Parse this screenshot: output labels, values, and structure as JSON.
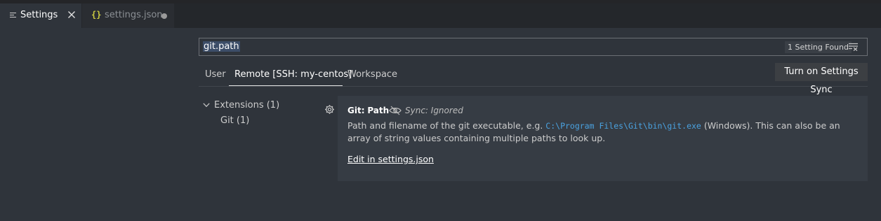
{
  "tabs": [
    {
      "label": "Settings",
      "active": true
    },
    {
      "label": "settings.json",
      "dirty": true
    }
  ],
  "search": {
    "value": "git.path",
    "result_count": "1 Setting Found"
  },
  "scopes": [
    {
      "label": "User"
    },
    {
      "label": "Remote [SSH: my-centos]",
      "selected": true
    },
    {
      "label": "Workspace"
    }
  ],
  "sync_button": "Turn on Settings Sync",
  "toc": {
    "extensions": "Extensions (1)",
    "git": "Git (1)"
  },
  "setting": {
    "category": "Git:",
    "name": "Path",
    "sync_status": "Sync: Ignored",
    "description_before": "Path and filename of the git executable, e.g. ",
    "description_code": "C:\\Program Files\\Git\\bin\\git.exe",
    "description_after": " (Windows). This can also be an array of string values containing multiple paths to look up.",
    "edit_link": "Edit in settings.json"
  },
  "colors": {
    "background": "#2f343b",
    "tabbar": "#24272b",
    "card": "#363c44",
    "code": "#4aa2e0",
    "json_braces": "#cbcb41"
  }
}
